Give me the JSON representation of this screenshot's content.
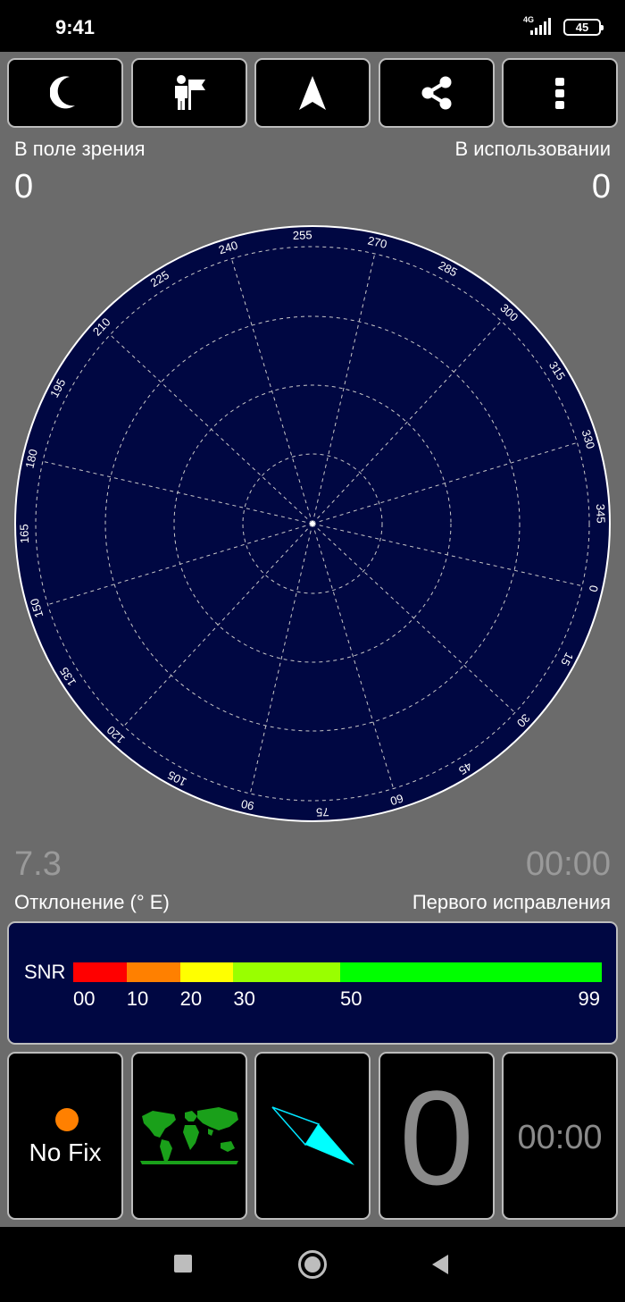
{
  "status_bar": {
    "time": "9:41",
    "network": "4G",
    "battery": "45"
  },
  "toolbar": {
    "buttons": [
      {
        "icon": "night-mode-icon"
      },
      {
        "icon": "person-flag-icon"
      },
      {
        "icon": "navigation-arrow-icon"
      },
      {
        "icon": "share-icon"
      },
      {
        "icon": "more-vert-icon"
      }
    ]
  },
  "satellites": {
    "in_view_label": "В поле зрения",
    "in_view_count": "0",
    "in_use_label": "В использовании",
    "in_use_count": "0"
  },
  "sky_plot": {
    "bearing_labels": [
      "0",
      "15",
      "30",
      "45",
      "60",
      "75",
      "90",
      "105",
      "120",
      "135",
      "150",
      "165",
      "180",
      "195",
      "210",
      "225",
      "240",
      "255",
      "270",
      "285",
      "300",
      "315",
      "330",
      "345"
    ],
    "colors": {
      "background": "#000742",
      "grid": "#c8c8c8",
      "ring": "#ffffff"
    }
  },
  "declination": {
    "value": "7.3",
    "label": "Отклонение (° E)"
  },
  "first_fix": {
    "value": "00:00",
    "label": "Первого исправления"
  },
  "snr": {
    "label": "SNR",
    "ticks": [
      "00",
      "10",
      "20",
      "30",
      "50",
      "99"
    ],
    "segments": [
      {
        "from": 0,
        "to": 10,
        "color": "#ff0000"
      },
      {
        "from": 10,
        "to": 20,
        "color": "#ff8000"
      },
      {
        "from": 20,
        "to": 30,
        "color": "#ffff00"
      },
      {
        "from": 30,
        "to": 50,
        "color": "#99ff00"
      },
      {
        "from": 50,
        "to": 99,
        "color": "#00ff00"
      }
    ]
  },
  "bottom_tiles": {
    "fix_status": "No Fix",
    "fix_dot_color": "#ff8000",
    "satellite_count": "0",
    "time": "00:00"
  },
  "nav_bar": {
    "icons": [
      "recent-apps-icon",
      "home-icon",
      "back-icon"
    ]
  }
}
